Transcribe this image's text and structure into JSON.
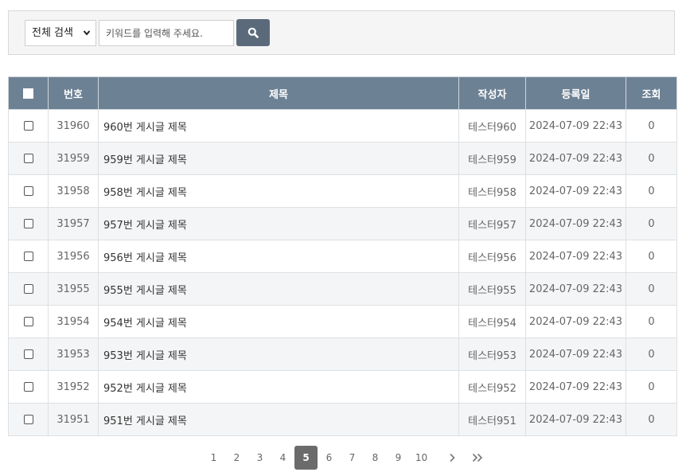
{
  "search": {
    "scope_value": "전체 검색",
    "keyword_placeholder": "키워드를 입력해 주세요."
  },
  "table": {
    "headers": {
      "no": "번호",
      "title": "제목",
      "author": "작성자",
      "date": "등록일",
      "views": "조회"
    },
    "rows": [
      {
        "no": "31960",
        "title": "960번 게시글 제목",
        "author": "테스터960",
        "date": "2024-07-09 22:43",
        "views": "0"
      },
      {
        "no": "31959",
        "title": "959번 게시글 제목",
        "author": "테스터959",
        "date": "2024-07-09 22:43",
        "views": "0"
      },
      {
        "no": "31958",
        "title": "958번 게시글 제목",
        "author": "테스터958",
        "date": "2024-07-09 22:43",
        "views": "0"
      },
      {
        "no": "31957",
        "title": "957번 게시글 제목",
        "author": "테스터957",
        "date": "2024-07-09 22:43",
        "views": "0"
      },
      {
        "no": "31956",
        "title": "956번 게시글 제목",
        "author": "테스터956",
        "date": "2024-07-09 22:43",
        "views": "0"
      },
      {
        "no": "31955",
        "title": "955번 게시글 제목",
        "author": "테스터955",
        "date": "2024-07-09 22:43",
        "views": "0"
      },
      {
        "no": "31954",
        "title": "954번 게시글 제목",
        "author": "테스터954",
        "date": "2024-07-09 22:43",
        "views": "0"
      },
      {
        "no": "31953",
        "title": "953번 게시글 제목",
        "author": "테스터953",
        "date": "2024-07-09 22:43",
        "views": "0"
      },
      {
        "no": "31952",
        "title": "952번 게시글 제목",
        "author": "테스터952",
        "date": "2024-07-09 22:43",
        "views": "0"
      },
      {
        "no": "31951",
        "title": "951번 게시글 제목",
        "author": "테스터951",
        "date": "2024-07-09 22:43",
        "views": "0"
      }
    ]
  },
  "pagination": {
    "pages": [
      "1",
      "2",
      "3",
      "4",
      "5",
      "6",
      "7",
      "8",
      "9",
      "10"
    ],
    "current": "5",
    "next_icon": "chevron-right-icon",
    "last_icon": "double-chevron-right-icon"
  },
  "colors": {
    "header_bg": "#6d8194",
    "search_button_bg": "#5b6a7b",
    "active_page_bg": "#6b6b6b"
  }
}
